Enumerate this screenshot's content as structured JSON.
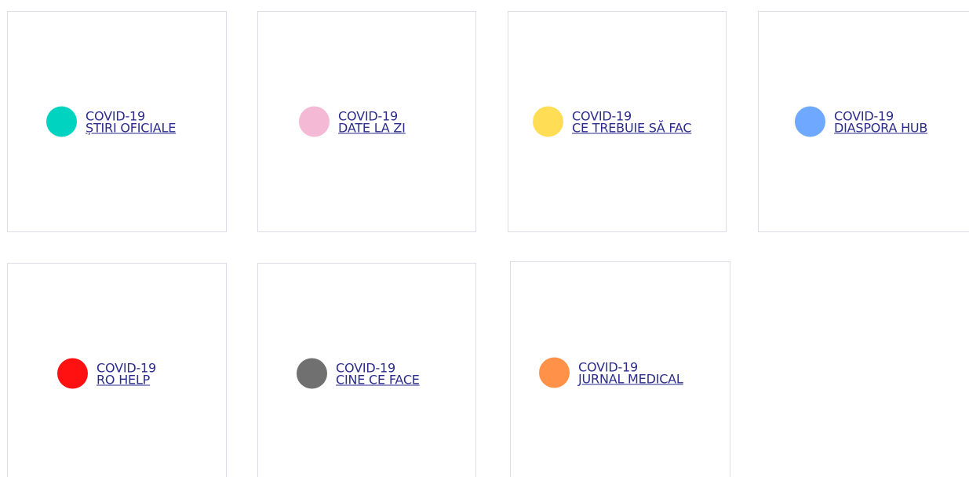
{
  "cards": [
    {
      "title": "COVID-19",
      "link": "ȘTIRI OFICIALE",
      "dot_color": "#00d4c0"
    },
    {
      "title": "COVID-19",
      "link": "DATE LA ZI",
      "dot_color": "#f4b9d4"
    },
    {
      "title": "COVID-19",
      "link": "CE TREBUIE SĂ FAC",
      "dot_color": "#ffdd55"
    },
    {
      "title": "COVID-19",
      "link": "DIASPORA HUB",
      "dot_color": "#6fa8ff"
    },
    {
      "title": "COVID-19",
      "link": "RO HELP",
      "dot_color": "#ff1111"
    },
    {
      "title": "COVID-19",
      "link": "CINE CE FACE",
      "dot_color": "#707070"
    },
    {
      "title": "COVID-19",
      "link": "JURNAL MEDICAL",
      "dot_color": "#ff9148"
    }
  ],
  "colors": {
    "text": "#2c2c8c",
    "border": "#dcdde8",
    "background": "#ffffff"
  }
}
